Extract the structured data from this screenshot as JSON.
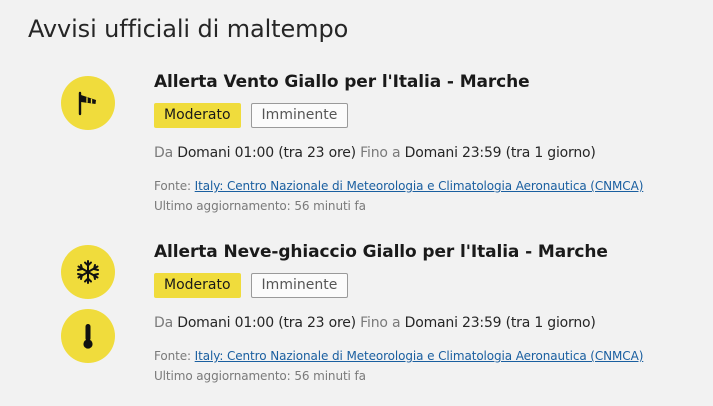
{
  "page": {
    "title": "Avvisi ufficiali di maltempo"
  },
  "alerts": [
    {
      "title": "Allerta Vento Giallo per l'Italia - Marche",
      "severity": "Moderato",
      "urgency": "Imminente",
      "from_label": "Da",
      "from_value": "Domani 01:00 (tra 23 ore)",
      "to_label": "Fino a",
      "to_value": "Domani 23:59 (tra 1 giorno)",
      "source_label": "Fonte:",
      "source_link": "Italy: Centro Nazionale di Meteorologia e Climatologia Aeronautica (CNMCA)",
      "updated": "Ultimo aggiornamento: 56 minuti fa",
      "icons": [
        "windsock-icon"
      ]
    },
    {
      "title": "Allerta Neve-ghiaccio Giallo per l'Italia - Marche",
      "severity": "Moderato",
      "urgency": "Imminente",
      "from_label": "Da",
      "from_value": "Domani 01:00 (tra 23 ore)",
      "to_label": "Fino a",
      "to_value": "Domani 23:59 (tra 1 giorno)",
      "source_label": "Fonte:",
      "source_link": "Italy: Centro Nazionale di Meteorologia e Climatologia Aeronautica (CNMCA)",
      "updated": "Ultimo aggiornamento: 56 minuti fa",
      "icons": [
        "snowflake-icon",
        "thermometer-icon"
      ]
    }
  ],
  "colors": {
    "severity_yellow": "#f0dc3c",
    "link_blue": "#1a5fa0",
    "background": "#f2f2f2"
  }
}
